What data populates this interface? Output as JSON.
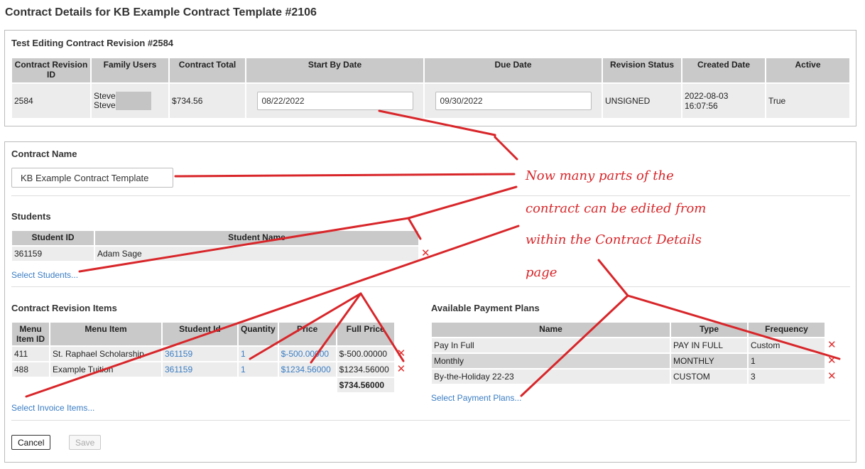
{
  "page": {
    "title": "Contract Details for KB Example Contract Template #2106"
  },
  "revision": {
    "title": "Test Editing Contract Revision #2584",
    "headers": [
      "Contract Revision ID",
      "Family Users",
      "Contract Total",
      "Start By Date",
      "Due Date",
      "Revision Status",
      "Created Date",
      "Active"
    ],
    "row": {
      "id": "2584",
      "family_user_1": "Steve",
      "family_user_2": "Steve",
      "total": "$734.56",
      "start_by_date": "08/22/2022",
      "due_date": "09/30/2022",
      "status": "UNSIGNED",
      "created_date": "2022-08-03 16:07:56",
      "active": "True"
    }
  },
  "contract": {
    "name_label": "Contract Name",
    "name_value": "KB Example Contract Template"
  },
  "students": {
    "title": "Students",
    "headers": [
      "Student ID",
      "Student Name"
    ],
    "rows": [
      {
        "id": "361159",
        "name": "Adam Sage"
      }
    ],
    "select_link": "Select Students..."
  },
  "items": {
    "title": "Contract Revision Items",
    "headers": [
      "Menu Item ID",
      "Menu Item",
      "Student Id",
      "Quantity",
      "Price",
      "Full Price"
    ],
    "rows": [
      {
        "id": "411",
        "item": "St. Raphael Scholarship",
        "student": "361159",
        "qty": "1",
        "price": "$-500.00000",
        "full": "$-500.00000"
      },
      {
        "id": "488",
        "item": "Example Tuition",
        "student": "361159",
        "qty": "1",
        "price": "$1234.56000",
        "full": "$1234.56000"
      }
    ],
    "total": "$734.56000",
    "select_link": "Select Invoice Items..."
  },
  "plans": {
    "title": "Available Payment Plans",
    "headers": [
      "Name",
      "Type",
      "Frequency"
    ],
    "rows": [
      {
        "name": "Pay In Full",
        "type": "PAY IN FULL",
        "freq": "Custom"
      },
      {
        "name": "Monthly",
        "type": "MONTHLY",
        "freq": "1"
      },
      {
        "name": "By-the-Holiday 22-23",
        "type": "CUSTOM",
        "freq": "3"
      }
    ],
    "select_link": "Select Payment Plans..."
  },
  "buttons": {
    "cancel": "Cancel",
    "save": "Save"
  },
  "icons": {
    "remove": "close-x-icon"
  },
  "colors": {
    "annotation": "#d8262a",
    "link": "#3a7dc4",
    "remove": "#e03030",
    "header_bg": "#c9c9c9",
    "row_bg": "#ececec"
  },
  "annotation": {
    "line1": "Now many parts of the",
    "line2": "contract can be edited from",
    "line3": "within the Contract Details",
    "line4": "page"
  }
}
